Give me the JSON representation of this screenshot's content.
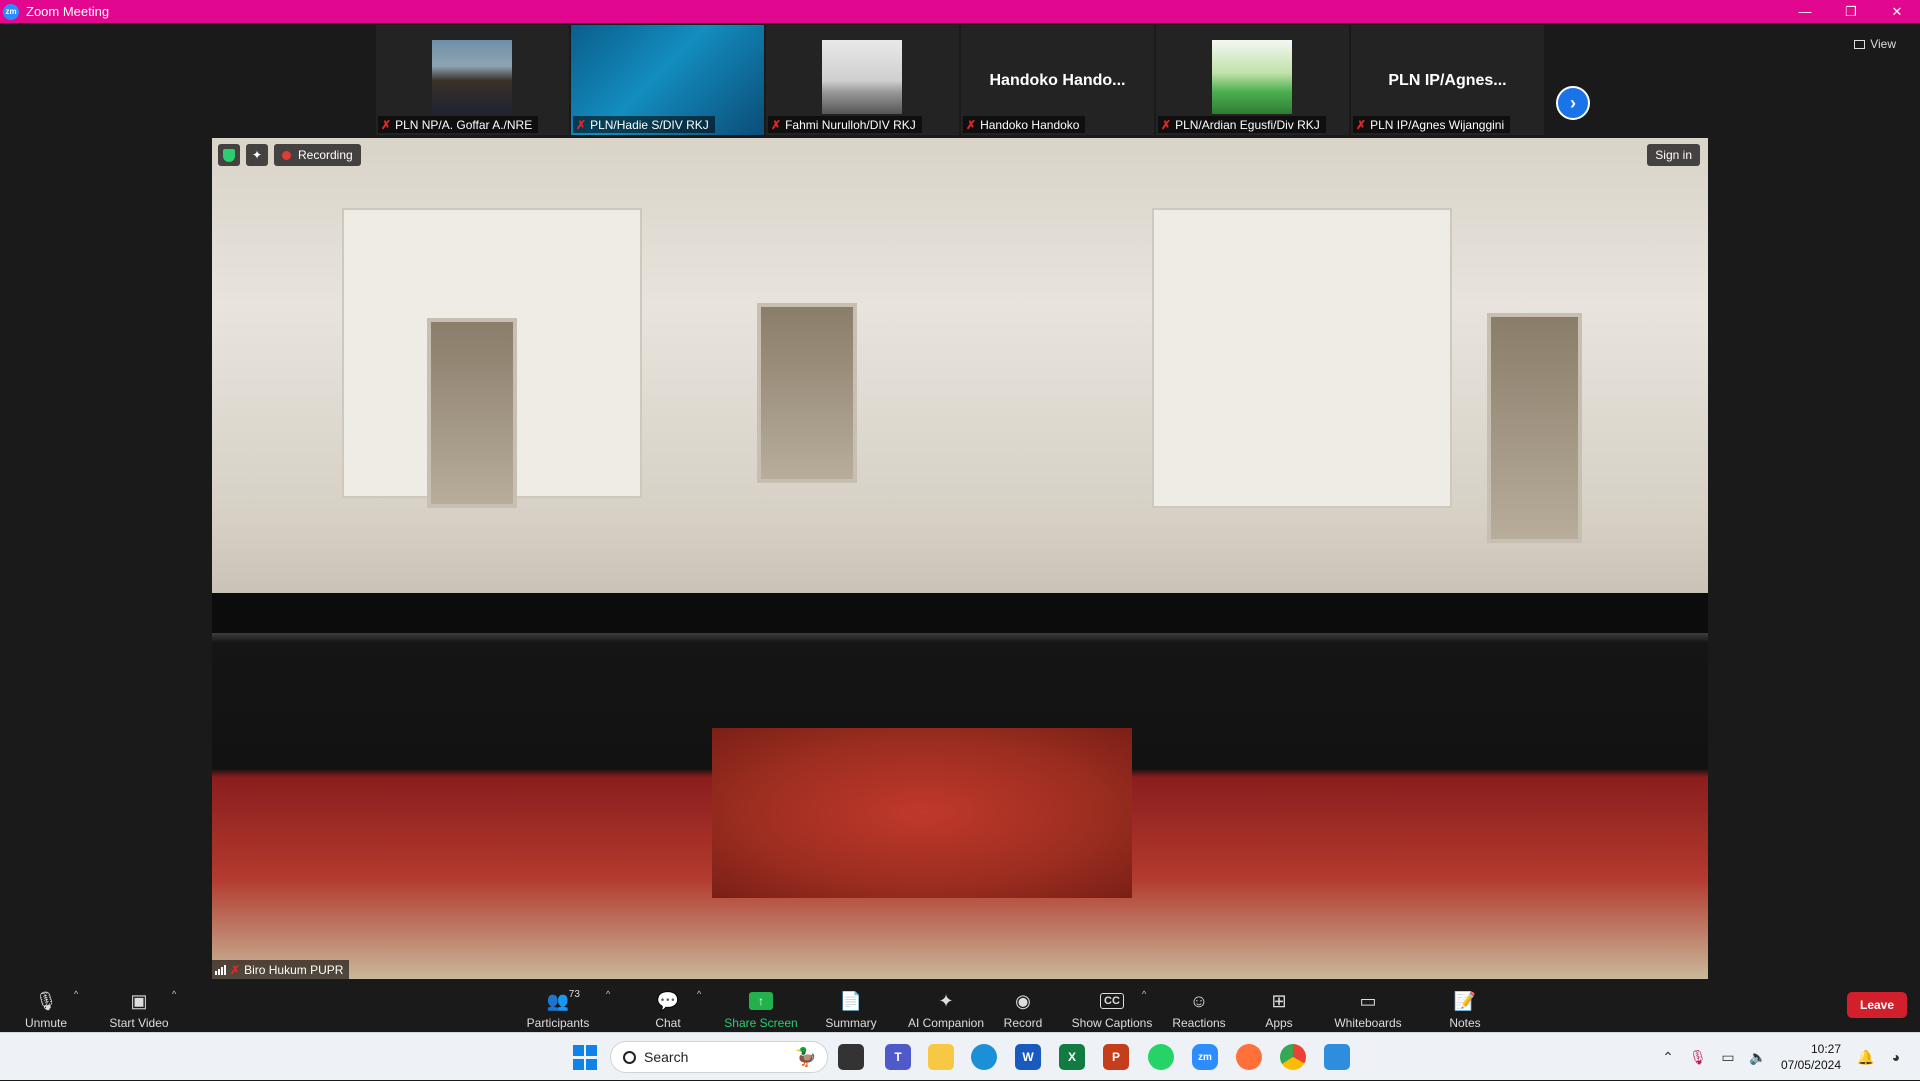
{
  "window": {
    "app_logo": "zm",
    "title": "Zoom Meeting",
    "controls": [
      "—",
      "❐",
      "✕"
    ]
  },
  "view_button": "View",
  "gallery": [
    {
      "label": "PLN NP/A. Goffar A./NRE",
      "type": "video-person",
      "big_name": ""
    },
    {
      "label": "PLN/Hadie S/DIV RKJ",
      "type": "video-slide",
      "big_name": ""
    },
    {
      "label": "Fahmi Nurulloh/DIV RKJ",
      "type": "video-beach",
      "big_name": ""
    },
    {
      "label": "Handoko Handoko",
      "type": "no-video",
      "big_name": "Handoko  Hando..."
    },
    {
      "label": "PLN/Ardian Egusfi/Div RKJ",
      "type": "video-green",
      "big_name": ""
    },
    {
      "label": "PLN IP/Agnes Wijanggini",
      "type": "no-video",
      "big_name": "PLN IP/Agnes..."
    }
  ],
  "next_page_glyph": "›",
  "speaker": {
    "recording_label": "Recording",
    "sign_in": "Sign in",
    "name": "Biro Hukum PUPR"
  },
  "toolbar": {
    "unmute": "Unmute",
    "start_video": "Start Video",
    "participants": "Participants",
    "participants_count": "73",
    "chat": "Chat",
    "share_screen": "Share Screen",
    "summary": "Summary",
    "ai_companion": "AI Companion",
    "record": "Record",
    "show_captions": "Show Captions",
    "captions_glyph": "CC",
    "reactions": "Reactions",
    "apps": "Apps",
    "whiteboards": "Whiteboards",
    "notes": "Notes",
    "leave": "Leave"
  },
  "taskbar": {
    "search_placeholder": "Search",
    "apps": [
      "task-view",
      "teams",
      "file-explorer",
      "edge",
      "word",
      "excel",
      "powerpoint",
      "whatsapp",
      "zoom",
      "firefox",
      "chrome",
      "notepad"
    ],
    "app_glyphs": {
      "teams": "T",
      "word": "W",
      "excel": "X",
      "powerpoint": "P",
      "zoom": "zm"
    },
    "time": "10:27",
    "date": "07/05/2024"
  },
  "colors": {
    "title_bar": "#e1078f",
    "share_green": "#23b14d",
    "leave_red": "#d21f2c",
    "accent_blue": "#1a73e8"
  }
}
